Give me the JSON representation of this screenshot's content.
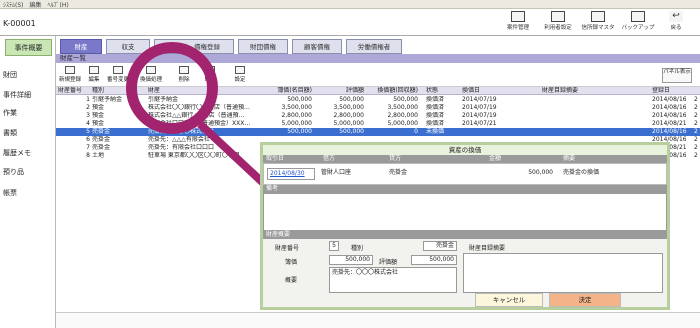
{
  "menu": [
    "ｼｽﾃﾑ(S)",
    "編集",
    "ﾍﾙﾌﾟ(H)"
  ],
  "case_number": "K-00001",
  "top_toolbar": [
    {
      "label": "案件管理",
      "icon": "case-icon"
    },
    {
      "label": "利用者設定",
      "icon": "user-settings-icon"
    },
    {
      "label": "信所録マスタ",
      "icon": "address-master-icon"
    },
    {
      "label": "バックアップ",
      "icon": "backup-icon"
    },
    {
      "label": "戻る",
      "icon": "back-icon"
    }
  ],
  "sidebar": {
    "active": "事件概要",
    "items": [
      "財団",
      "事件詳細",
      "作業",
      "書類",
      "履歴メモ",
      "預り品",
      "帳票"
    ]
  },
  "tabs": [
    "財産",
    "収支",
    "債権者・債権登録",
    "財団債権",
    "顧客債権",
    "労働債権者"
  ],
  "active_tab": "財産",
  "section_title": "財産一覧",
  "list_toolbar": [
    {
      "label": "新規登録",
      "icon": "new-icon"
    },
    {
      "label": "編集",
      "icon": "edit-icon"
    },
    {
      "label": "番号変更",
      "icon": "renumber-icon"
    },
    {
      "label": "換価処理",
      "icon": "liquidate-icon"
    },
    {
      "label": "削除",
      "icon": "delete-icon"
    },
    {
      "label": "印刷",
      "icon": "print-icon"
    },
    {
      "label": "設定",
      "icon": "settings-icon"
    }
  ],
  "panel_button": "パネル表示",
  "table": {
    "headers": [
      "財産番号",
      "種別",
      "財産",
      "簿価(名目額)",
      "評価額",
      "換価額(回収額)",
      "状態",
      "換価日",
      "財産目録摘要",
      "登録日"
    ],
    "rows": [
      [
        "1",
        "引継予納金",
        "引継予納金",
        "500,000",
        "500,000",
        "500,000",
        "換価済",
        "2014/07/19",
        "",
        "2014/08/16"
      ],
      [
        "2",
        "預金",
        "株式会社〇〇銀行〇〇支店（普通預…",
        "3,500,000",
        "3,500,000",
        "3,500,000",
        "換価済",
        "2014/07/19",
        "",
        "2014/08/16"
      ],
      [
        "3",
        "預金",
        "株式会社△△銀行△△支店（普通預…",
        "2,800,000",
        "2,800,000",
        "2,800,000",
        "換価済",
        "2014/07/19",
        "",
        "2014/08/16"
      ],
      [
        "4",
        "預金",
        "株式会社口口銀行（普通預金）XXX…",
        "5,000,000",
        "5,000,000",
        "5,000,000",
        "換価済",
        "2014/07/21",
        "",
        "2014/08/21"
      ],
      [
        "5",
        "売掛金",
        "売掛先：〇〇〇株式会社",
        "500,000",
        "500,000",
        "0",
        "未換価",
        "",
        "",
        "2014/08/16"
      ],
      [
        "6",
        "売掛金",
        "売掛先：△△△有限会社",
        "",
        "",
        "",
        "",
        "",
        "",
        "2014/08/16"
      ],
      [
        "7",
        "売掛金",
        "売掛先：有限会社口口口",
        "",
        "",
        "",
        "",
        "",
        "",
        "2014/08/21"
      ],
      [
        "8",
        "土地",
        "駐車場 東京都〇〇区〇〇町〇丁目",
        "",
        "",
        "",
        "",
        "",
        "",
        "2014/08/16"
      ]
    ],
    "selected_row": 4,
    "extra_col": "2"
  },
  "dialog": {
    "title": "資産の換価",
    "headers": [
      "取引日",
      "借方",
      "貸方",
      "金額",
      "摘要"
    ],
    "entry": [
      "2014/08/30",
      "管財人口座",
      "売掛金",
      "500,000",
      "売掛金の換価"
    ],
    "notes_label": "備考",
    "summary_label": "財産概要",
    "asset_no_label": "財産番号",
    "asset_no": "5",
    "type_label": "種別",
    "type_value": "売掛金",
    "catalog_label": "財産目録摘要",
    "book_label": "簿価",
    "book_value": "500,000",
    "eval_label": "評価額",
    "eval_value": "500,000",
    "overview_label": "概要",
    "overview_value": "売掛先：〇〇〇株式会社",
    "cancel": "キャンセル",
    "ok": "決定"
  },
  "colors": {
    "highlight": "#a2246e",
    "dialog_border": "#b7cf9c",
    "tab_active": "#7a78c8",
    "ok_button": "#f4b488",
    "selected_row": "#3b6fcf"
  }
}
